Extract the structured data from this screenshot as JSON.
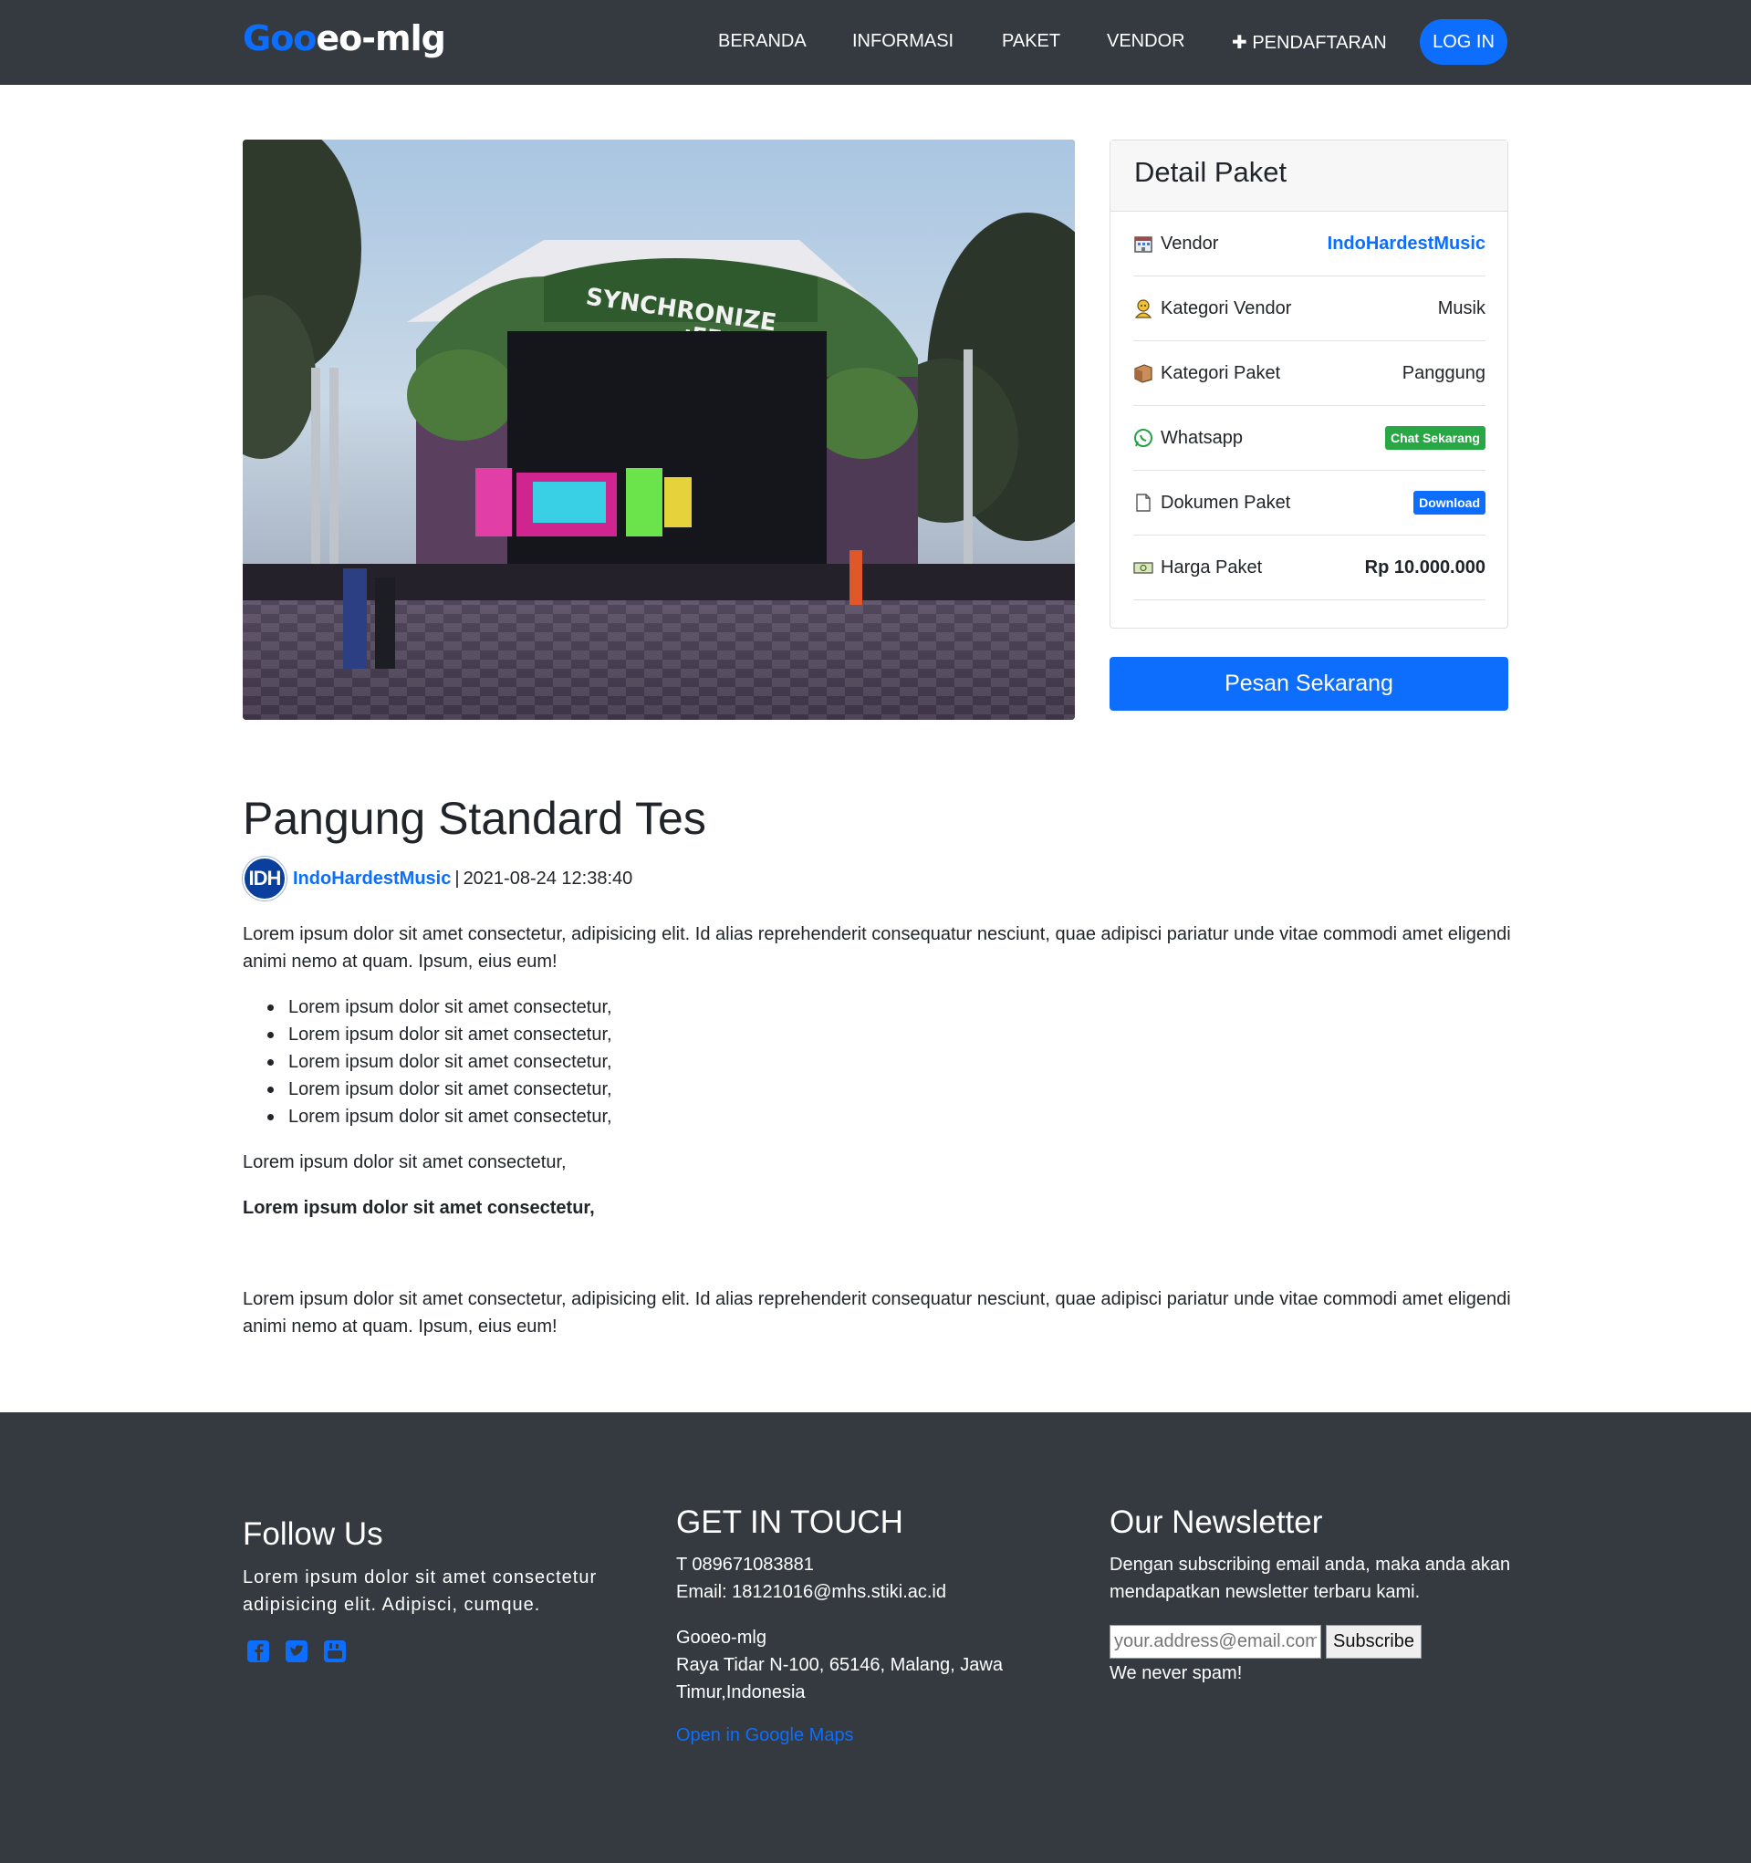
{
  "nav": {
    "brand_part1": "Goo",
    "brand_part2": "eo-mlg",
    "items": [
      "BERANDA",
      "INFORMASI",
      "PAKET",
      "VENDOR",
      "PENDAFTARAN"
    ],
    "register_prefix": "✚",
    "login": "LOG IN"
  },
  "detail": {
    "header": "Detail Paket",
    "rows": [
      {
        "label": "Vendor",
        "value": "IndoHardestMusic",
        "icon": "building-icon"
      },
      {
        "label": "Kategori Vendor",
        "value": "Musik",
        "icon": "person-icon"
      },
      {
        "label": "Kategori Paket",
        "value": "Panggung",
        "icon": "package-icon"
      },
      {
        "label": "Whatsapp",
        "value": "Chat Sekarang",
        "icon": "whatsapp-icon"
      },
      {
        "label": "Dokumen Paket",
        "value": "Download",
        "icon": "document-icon"
      },
      {
        "label": "Harga Paket",
        "value": "Rp 10.000.000",
        "icon": "money-icon"
      }
    ],
    "order_button": "Pesan Sekarang"
  },
  "hero": {
    "sign_line1": "SYNCHRONIZE",
    "sign_line2": ":FEST"
  },
  "article": {
    "title": "Pangung Standard Tes",
    "avatar_text": "IDH",
    "author": "IndoHardestMusic",
    "separator": "|",
    "date": "2021-08-24 12:38:40",
    "intro": "Lorem ipsum dolor sit amet consectetur, adipisicing elit. Id alias reprehenderit consequatur nesciunt, quae adipisci pariatur unde vitae commodi amet eligendi animi nemo at quam. Ipsum, eius eum!",
    "bullets": [
      "Lorem ipsum dolor sit amet consectetur,",
      "Lorem ipsum dolor sit amet consectetur,",
      "Lorem ipsum dolor sit amet consectetur,",
      "Lorem ipsum dolor sit amet consectetur,",
      "Lorem ipsum dolor sit amet consectetur,"
    ],
    "line1": "Lorem ipsum dolor sit amet consectetur,",
    "line_bold": "Lorem ipsum dolor sit amet consectetur,",
    "outro": "Lorem ipsum dolor sit amet consectetur, adipisicing elit. Id alias reprehenderit consequatur nesciunt, quae adipisci pariatur unde vitae commodi amet eligendi animi nemo at quam. Ipsum, eius eum!"
  },
  "footer": {
    "follow_title": "Follow Us",
    "follow_text": "Lorem ipsum dolor sit amet consectetur adipisicing elit. Adipisci, cumque.",
    "social_icons": [
      "facebook-icon",
      "twitter-icon",
      "youtube-icon"
    ],
    "contact_title": "GET IN TOUCH",
    "phone": "T 089671083881",
    "email": "Email: 18121016@mhs.stiki.ac.id",
    "org": "Gooeo-mlg",
    "address": "Raya Tidar N-100, 65146, Malang, Jawa Timur,Indonesia",
    "maps_link": "Open in Google Maps",
    "newsletter_title": "Our Newsletter",
    "newsletter_text": "Dengan subscribing email anda, maka anda akan mendapatkan newsletter terbaru kami.",
    "newsletter_placeholder": "your.address@email.com",
    "subscribe": "Subscribe",
    "no_spam": "We never spam!"
  },
  "colors": {
    "navbar_bg": "#343a40",
    "primary": "#0d6efd",
    "success": "#28a745",
    "footer_bg": "#343a40"
  }
}
